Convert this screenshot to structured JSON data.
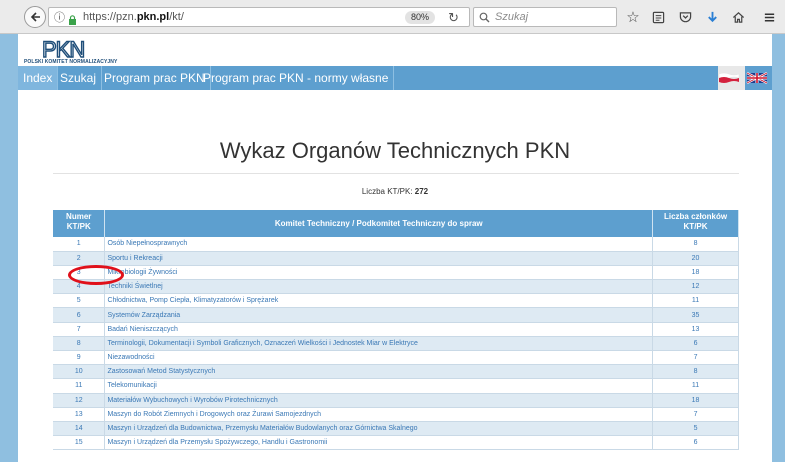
{
  "browser": {
    "url_prefix": "https://pzn.",
    "url_domain": "pkn.pl",
    "url_suffix": "/kt/",
    "zoom": "80%",
    "search_placeholder": "Szukaj"
  },
  "logo": {
    "letters": "PKN",
    "subtitle": "POLSKI KOMITET NORMALIZACYJNY"
  },
  "nav": {
    "items": [
      {
        "label": "Index",
        "active": true
      },
      {
        "label": "Szukaj",
        "active": false
      },
      {
        "label": "Program prac PKN",
        "active": false
      },
      {
        "label": "Program prac PKN - normy własne",
        "active": false
      }
    ]
  },
  "main": {
    "title": "Wykaz Organów Technicznych PKN",
    "count_label": "Liczba KT/PK:",
    "count_value": "272"
  },
  "table": {
    "headers": {
      "num": "Numer KT/PK",
      "name": "Komitet Techniczny / Podkomitet Techniczny do spraw",
      "count": "Liczba członków KT/PK"
    },
    "rows": [
      {
        "num": "1",
        "name": "Osób Niepełnosprawnych",
        "count": "8"
      },
      {
        "num": "2",
        "name": "Sportu i Rekreacji",
        "count": "20"
      },
      {
        "num": "3",
        "name": "Mikrobiologii Żywności",
        "count": "18"
      },
      {
        "num": "4",
        "name": "Techniki Świetlnej",
        "count": "12"
      },
      {
        "num": "5",
        "name": "Chłodnictwa, Pomp Ciepła, Klimatyzatorów i Sprężarek",
        "count": "11"
      },
      {
        "num": "6",
        "name": "Systemów Zarządzania",
        "count": "35"
      },
      {
        "num": "7",
        "name": "Badań Nieniszczących",
        "count": "13"
      },
      {
        "num": "8",
        "name": "Terminologii, Dokumentacji i Symboli Graficznych, Oznaczeń Wielkości i Jednostek Miar w Elektryce",
        "count": "6"
      },
      {
        "num": "9",
        "name": "Niezawodności",
        "count": "7"
      },
      {
        "num": "10",
        "name": "Zastosowań Metod Statystycznych",
        "count": "8"
      },
      {
        "num": "11",
        "name": "Telekomunikacji",
        "count": "11"
      },
      {
        "num": "12",
        "name": "Materiałów Wybuchowych i Wyrobów Pirotechnicznych",
        "count": "18"
      },
      {
        "num": "13",
        "name": "Maszyn do Robót Ziemnych i Drogowych oraz Żurawi Samojezdnych",
        "count": "7"
      },
      {
        "num": "14",
        "name": "Maszyn i Urządzeń dla Budownictwa, Przemysłu Materiałów Budowlanych oraz Górnictwa Skalnego",
        "count": "5"
      },
      {
        "num": "15",
        "name": "Maszyn i Urządzeń dla Przemysłu Spożywczego, Handlu i Gastronomii",
        "count": "6"
      }
    ]
  },
  "colors": {
    "nav_bg": "#5d9fcf",
    "link": "#3a78b5",
    "annotation": "#e0101a"
  }
}
